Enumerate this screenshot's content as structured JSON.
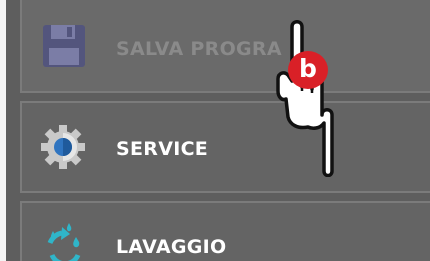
{
  "menu": {
    "items": [
      {
        "label": "SALVA PROGRA",
        "icon": "floppy-disk-icon",
        "state": "disabled"
      },
      {
        "label": "SERVICE",
        "icon": "gear-icon",
        "state": "enabled"
      },
      {
        "label": "LAVAGGIO",
        "icon": "water-recycle-icon",
        "state": "enabled"
      }
    ]
  },
  "overlay": {
    "pointer_icon": "pointing-hand-icon",
    "badge_letter": "b"
  },
  "colors": {
    "panel": "#5e5e5e",
    "item_background": "#646464",
    "item_border": "#7b7b7b",
    "label_active": "#ffffff",
    "label_disabled": "#8a8a8a",
    "gear_center": "#2f74c0",
    "washing_accent": "#2fb5c9",
    "badge": "#d92027"
  }
}
